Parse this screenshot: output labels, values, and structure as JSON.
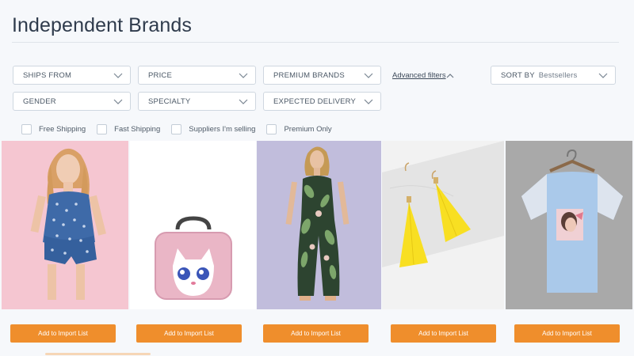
{
  "page": {
    "title": "Independent Brands"
  },
  "filters": {
    "ships_from": "SHIPS FROM",
    "price": "PRICE",
    "premium_brands": "PREMIUM BRANDS",
    "advanced_filters": "Advanced filters",
    "sort_by_label": "SORT BY",
    "sort_by_value": "Bestsellers",
    "gender": "GENDER",
    "specialty": "SPECIALTY",
    "expected_delivery": "EXPECTED DELIVERY"
  },
  "checkboxes": [
    {
      "label": "Free Shipping",
      "checked": false
    },
    {
      "label": "Fast Shipping",
      "checked": false
    },
    {
      "label": "Suppliers I'm selling",
      "checked": false
    },
    {
      "label": "Premium Only",
      "checked": false
    }
  ],
  "products": [
    {
      "image": "girl-polka-dot-outfit",
      "button": "Add to Import List"
    },
    {
      "image": "pink-cat-bag",
      "button": "Add to Import List"
    },
    {
      "image": "tropical-jumpsuit",
      "button": "Add to Import List"
    },
    {
      "image": "yellow-tassel-earrings",
      "button": "Add to Import List"
    },
    {
      "image": "blue-graphic-tee",
      "button": "Add to Import List"
    }
  ],
  "colors": {
    "accent": "#ef8e2c",
    "background": "#f6f8fb"
  }
}
